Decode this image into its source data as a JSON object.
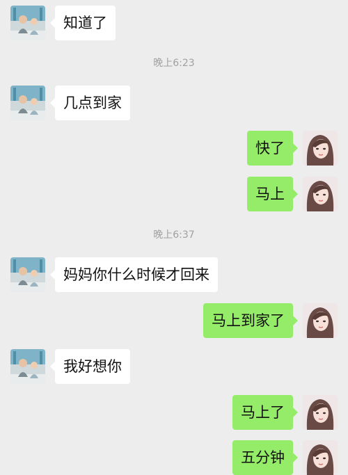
{
  "chat": {
    "colors": {
      "background": "#ededed",
      "incoming_bubble": "#ffffff",
      "outgoing_bubble": "#95ec69",
      "timestamp_text": "#a0a0a0"
    },
    "items": [
      {
        "type": "message",
        "direction": "incoming",
        "text": "知道了",
        "avatar": "child-avatar"
      },
      {
        "type": "timestamp",
        "text": "晚上6:23"
      },
      {
        "type": "message",
        "direction": "incoming",
        "text": "几点到家",
        "avatar": "child-avatar"
      },
      {
        "type": "message",
        "direction": "outgoing",
        "text": "快了",
        "avatar": "woman-avatar"
      },
      {
        "type": "message",
        "direction": "outgoing",
        "text": "马上",
        "avatar": "woman-avatar"
      },
      {
        "type": "timestamp",
        "text": "晚上6:37"
      },
      {
        "type": "message",
        "direction": "incoming",
        "text": "妈妈你什么时候才回来",
        "avatar": "child-avatar"
      },
      {
        "type": "message",
        "direction": "outgoing",
        "text": "马上到家了",
        "avatar": "woman-avatar"
      },
      {
        "type": "message",
        "direction": "incoming",
        "text": "我好想你",
        "avatar": "child-avatar"
      },
      {
        "type": "message",
        "direction": "outgoing",
        "text": "马上了",
        "avatar": "woman-avatar"
      },
      {
        "type": "message",
        "direction": "outgoing",
        "text": "五分钟",
        "avatar": "woman-avatar"
      }
    ]
  }
}
